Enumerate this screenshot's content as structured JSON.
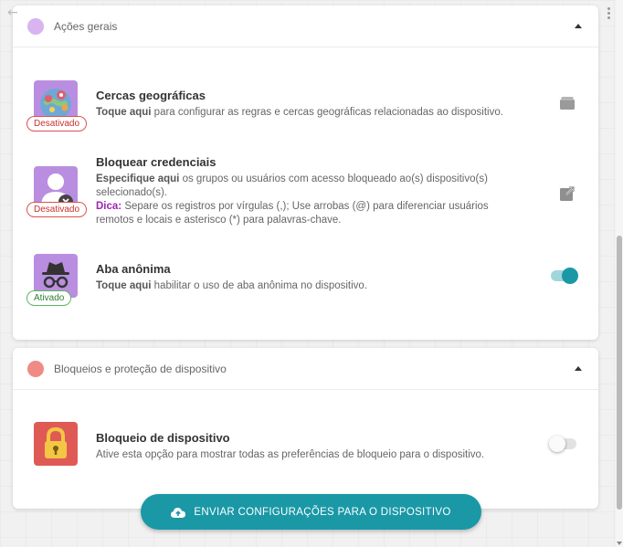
{
  "colors": {
    "accent": "#1a98a6",
    "section1_dot": "#d8b4f0",
    "section2_dot": "#f08a85",
    "off_badge": "#d9534f",
    "on_badge": "#5cb85c",
    "dica": "#9c27b0"
  },
  "sections": [
    {
      "title": "Ações gerais",
      "items": [
        {
          "title": "Cercas geográficas",
          "desc_strong": "Toque aqui",
          "desc": " para configurar as regras e cercas geográficas relacionadas ao dispositivo.",
          "badge": "Desativado",
          "icon": "map-pin-icon",
          "action": "folder-icon"
        },
        {
          "title": "Bloquear credenciais",
          "desc_strong": "Especifique aqui",
          "desc": " os grupos ou usuários com acesso bloqueado ao(s) dispositivo(s) selecionado(s).",
          "dica_label": "Dica:",
          "dica_text": " Separe os registros por vírgulas (,); Use arrobas (@) para diferenciar usuários remotos e locais e asterisco (*) para palavras-chave.",
          "badge": "Desativado",
          "icon": "blocked-user-icon",
          "action": "external-link-icon"
        },
        {
          "title": "Aba anônima",
          "desc_strong": "Toque aqui",
          "desc": " habilitar o uso de aba anônima no dispositivo.",
          "badge": "Ativado",
          "icon": "incognito-icon",
          "toggle": "on"
        }
      ]
    },
    {
      "title": "Bloqueios e proteção de dispositivo",
      "items": [
        {
          "title": "Bloqueio de dispositivo",
          "desc": "Ative esta opção para mostrar todas as preferências de bloqueio para o dispositivo.",
          "icon": "padlock-icon",
          "toggle": "off"
        }
      ]
    }
  ],
  "send_button": {
    "label": "ENVIAR CONFIGURAÇÕES PARA O DISPOSITIVO",
    "icon": "cloud-upload-icon"
  }
}
